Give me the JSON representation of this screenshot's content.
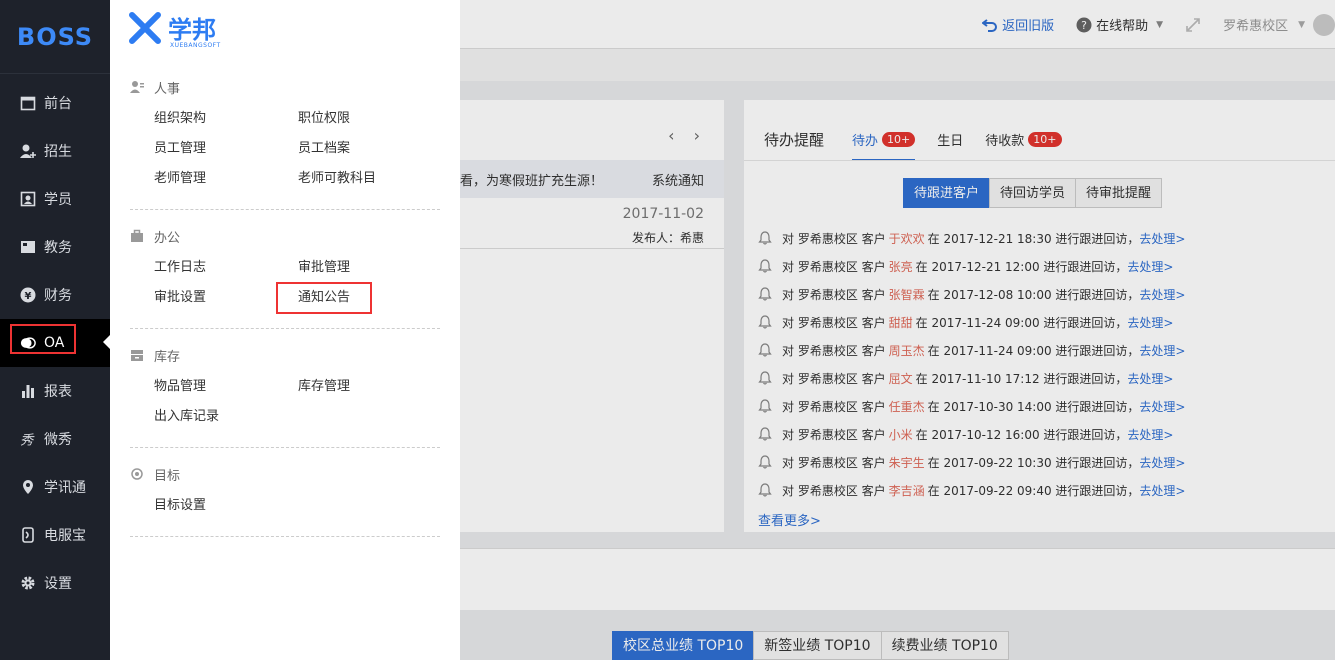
{
  "sidebar": {
    "logo": "BOSS",
    "items": [
      {
        "label": "前台",
        "icon": "calendar-icon"
      },
      {
        "label": "招生",
        "icon": "user-add-icon"
      },
      {
        "label": "学员",
        "icon": "id-card-icon"
      },
      {
        "label": "教务",
        "icon": "book-icon"
      },
      {
        "label": "财务",
        "icon": "yen-icon"
      },
      {
        "label": "OA",
        "icon": "chat-icon"
      },
      {
        "label": "报表",
        "icon": "bar-chart-icon"
      },
      {
        "label": "微秀",
        "icon": "xiu-icon"
      },
      {
        "label": "学讯通",
        "icon": "location-icon"
      },
      {
        "label": "电服宝",
        "icon": "phone-icon"
      },
      {
        "label": "设置",
        "icon": "gear-icon"
      }
    ]
  },
  "topbar": {
    "back_label": "返回旧版",
    "help_label": "在线帮助",
    "campus": "罗希惠校区"
  },
  "flyout": {
    "brand": "学邦",
    "brand_sub": "XUEBANGSOFT",
    "sections": [
      {
        "title": "人事",
        "items": [
          "组织架构",
          "职位权限",
          "员工管理",
          "员工档案",
          "老师管理",
          "老师可教科目"
        ]
      },
      {
        "title": "办公",
        "items": [
          "工作日志",
          "审批管理",
          "审批设置",
          "通知公告"
        ]
      },
      {
        "title": "库存",
        "items": [
          "物品管理",
          "库存管理",
          "出入库记录"
        ]
      },
      {
        "title": "目标",
        "items": [
          "目标设置"
        ]
      }
    ]
  },
  "notice": {
    "text": "看，为寒假班扩充生源！",
    "type": "系统通知",
    "date": "2017-11-02",
    "publisher": "发布人：希惠"
  },
  "todo": {
    "title": "待办提醒",
    "tabs": [
      {
        "label": "待办",
        "badge": "10+"
      },
      {
        "label": "生日",
        "badge": ""
      },
      {
        "label": "待收款",
        "badge": "10+"
      }
    ],
    "segments": [
      "待跟进客户",
      "待回访学员",
      "待审批提醒"
    ],
    "prefix": "对 罗希惠校区 客户",
    "rows": [
      {
        "name": "于欢欢",
        "time": "在 2017-12-21 18:30 进行跟进回访，"
      },
      {
        "name": "张亮",
        "time": "在 2017-12-21 12:00 进行跟进回访，"
      },
      {
        "name": "张智霖",
        "time": "在 2017-12-08 10:00 进行跟进回访，"
      },
      {
        "name": "甜甜",
        "time": "在 2017-11-24 09:00 进行跟进回访，"
      },
      {
        "name": "周玉杰",
        "time": "在 2017-11-24 09:00 进行跟进回访，"
      },
      {
        "name": "屈文",
        "time": "在 2017-11-10 17:12 进行跟进回访，"
      },
      {
        "name": "任重杰",
        "time": "在 2017-10-30 14:00 进行跟进回访，"
      },
      {
        "name": "小米",
        "time": "在 2017-10-12 16:00 进行跟进回访，"
      },
      {
        "name": "朱宇生",
        "time": "在 2017-09-22 10:30 进行跟进回访，"
      },
      {
        "name": "李吉涵",
        "time": "在 2017-09-22 09:40 进行跟进回访，"
      }
    ],
    "action": "去处理>",
    "more": "查看更多>"
  },
  "bottom_tabs": [
    "校区总业绩 TOP10",
    "新签业绩 TOP10",
    "续费业绩 TOP10"
  ]
}
